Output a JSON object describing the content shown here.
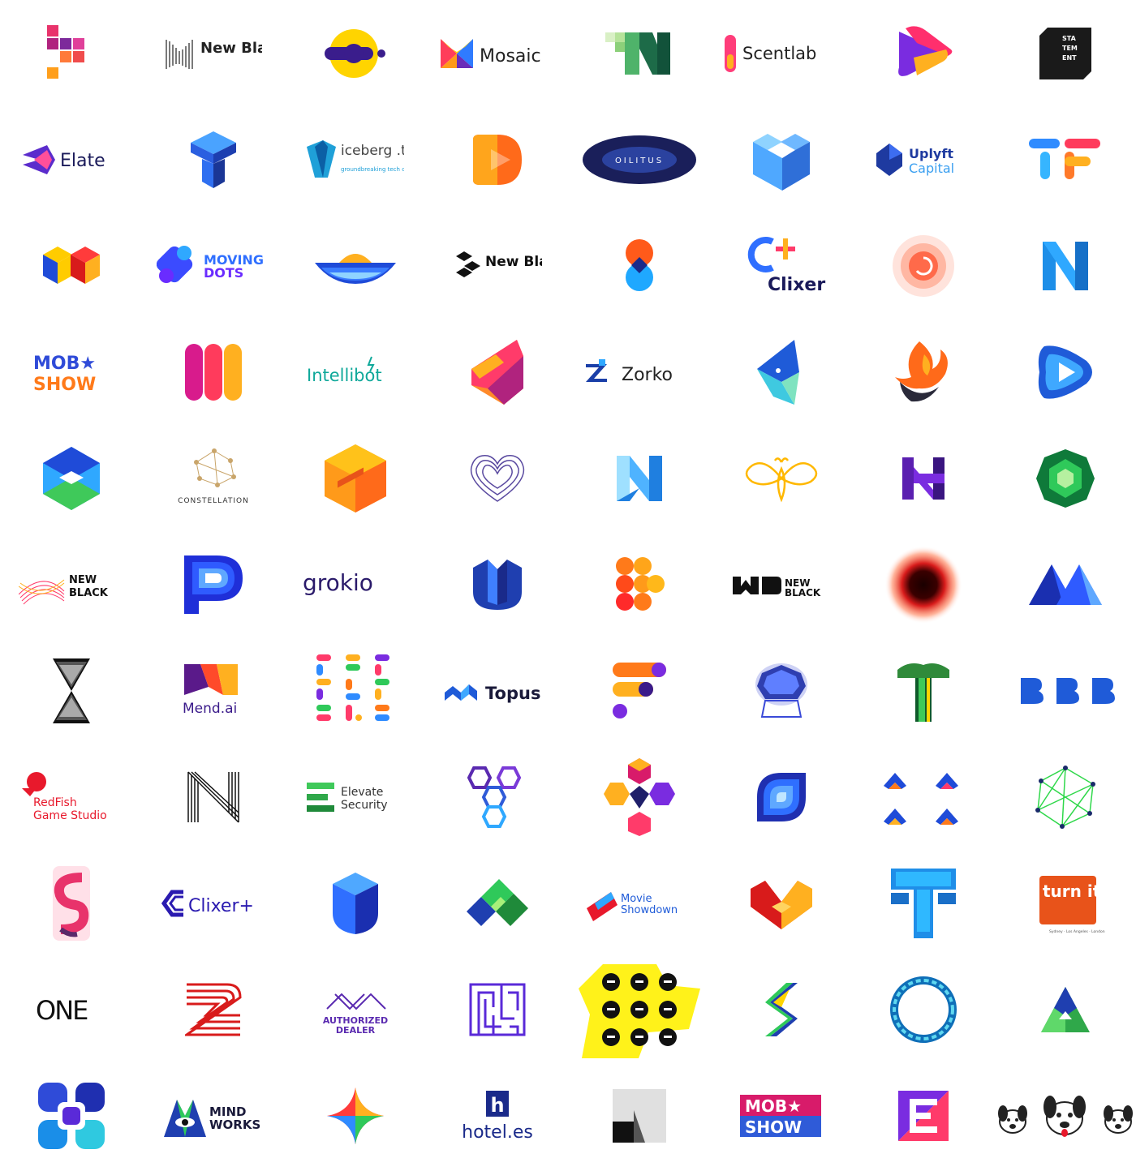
{
  "logos": [
    {
      "id": "pixel-n-mark",
      "text": ""
    },
    {
      "id": "new-black-1",
      "text": "New Black"
    },
    {
      "id": "yellow-c-orbit",
      "text": ""
    },
    {
      "id": "mosaic",
      "text": "Mosaic"
    },
    {
      "id": "green-n-pixel",
      "text": ""
    },
    {
      "id": "scentlab",
      "text": "Scentlab"
    },
    {
      "id": "play-ribbon",
      "text": ""
    },
    {
      "id": "statement",
      "text": "STA TEM ENT"
    },
    {
      "id": "elate",
      "text": "Elate"
    },
    {
      "id": "blue-t-cube",
      "text": ""
    },
    {
      "id": "iceberg-tech",
      "text": "iceberg .tech",
      "sub": "groundbreaking tech companies"
    },
    {
      "id": "orange-play",
      "text": ""
    },
    {
      "id": "oilitus",
      "text": "OILITUS"
    },
    {
      "id": "blue-cube-heart",
      "text": ""
    },
    {
      "id": "uplyft-capital",
      "text": "Uplyft",
      "sub": "Capital"
    },
    {
      "id": "tf-ribbons",
      "text": ""
    },
    {
      "id": "lego-heart",
      "text": ""
    },
    {
      "id": "moving-dots",
      "text": "MOVING",
      "sub": "DOTS"
    },
    {
      "id": "sunrise-waves",
      "text": ""
    },
    {
      "id": "new-black-2",
      "text": "New Black"
    },
    {
      "id": "figure-eight",
      "text": ""
    },
    {
      "id": "clixer-plus-1",
      "text": "Clixer+"
    },
    {
      "id": "spiral-sun",
      "text": ""
    },
    {
      "id": "blue-n-fold",
      "text": ""
    },
    {
      "id": "mob-show-1",
      "text": "MOB★",
      "sub": "SHOW"
    },
    {
      "id": "gradient-m",
      "text": ""
    },
    {
      "id": "intellibot",
      "text": "Intellibot"
    },
    {
      "id": "gradient-prism",
      "text": ""
    },
    {
      "id": "zorko",
      "text": "Zorko"
    },
    {
      "id": "blue-bird",
      "text": ""
    },
    {
      "id": "fire-phoenix",
      "text": ""
    },
    {
      "id": "blob-play",
      "text": ""
    },
    {
      "id": "hex-cube",
      "text": ""
    },
    {
      "id": "constellation",
      "text": "CONSTELLATION"
    },
    {
      "id": "orange-s-cube",
      "text": ""
    },
    {
      "id": "line-heart",
      "text": ""
    },
    {
      "id": "light-blue-n",
      "text": ""
    },
    {
      "id": "yellow-bee",
      "text": ""
    },
    {
      "id": "purple-n",
      "text": ""
    },
    {
      "id": "green-gem",
      "text": ""
    },
    {
      "id": "new-black-3",
      "text": "NEW",
      "sub": "BLACK"
    },
    {
      "id": "blue-p",
      "text": ""
    },
    {
      "id": "grokio",
      "text": "grokio"
    },
    {
      "id": "blue-tulip",
      "text": ""
    },
    {
      "id": "orange-dots",
      "text": ""
    },
    {
      "id": "new-black-4",
      "text": "NEW",
      "sub": "BLACK"
    },
    {
      "id": "black-hole",
      "text": ""
    },
    {
      "id": "blue-mountains",
      "text": ""
    },
    {
      "id": "hourglass",
      "text": ""
    },
    {
      "id": "mend-ai",
      "text": "Mend.ai"
    },
    {
      "id": "dot-grid",
      "text": ""
    },
    {
      "id": "topus",
      "text": "Topus"
    },
    {
      "id": "f-pills",
      "text": ""
    },
    {
      "id": "gem-ring",
      "text": ""
    },
    {
      "id": "green-t",
      "text": ""
    },
    {
      "id": "three-b",
      "text": ""
    },
    {
      "id": "redfish",
      "text": "RedFish",
      "sub": "Game Studio"
    },
    {
      "id": "line-n",
      "text": ""
    },
    {
      "id": "elevate-security",
      "text": "Elevate",
      "sub": "Security"
    },
    {
      "id": "hex-trio",
      "text": ""
    },
    {
      "id": "cube-flower",
      "text": ""
    },
    {
      "id": "blue-leaf",
      "text": ""
    },
    {
      "id": "crown-set",
      "text": ""
    },
    {
      "id": "green-network",
      "text": ""
    },
    {
      "id": "pink-s",
      "text": ""
    },
    {
      "id": "clixer-plus-2",
      "text": "Clixer+"
    },
    {
      "id": "blue-shield",
      "text": ""
    },
    {
      "id": "green-check",
      "text": ""
    },
    {
      "id": "movie-showdown",
      "text": "Movie",
      "sub": "Showdown"
    },
    {
      "id": "orange-m",
      "text": ""
    },
    {
      "id": "blue-t-pixel",
      "text": ""
    },
    {
      "id": "turn-it-up",
      "text": "turn it up",
      "sub": "Sydney · Los Angeles · London"
    },
    {
      "id": "one",
      "text": "ONE"
    },
    {
      "id": "red-z-lines",
      "text": ""
    },
    {
      "id": "authorized-dealer",
      "text": "AUTHORIZED",
      "sub": "DEALER"
    },
    {
      "id": "maze",
      "text": ""
    },
    {
      "id": "gorillas",
      "text": ""
    },
    {
      "id": "ribbon-s",
      "text": ""
    },
    {
      "id": "blue-ring",
      "text": ""
    },
    {
      "id": "green-a",
      "text": ""
    },
    {
      "id": "blue-knot",
      "text": ""
    },
    {
      "id": "mind-works",
      "text": "MIND",
      "sub": "WORKS"
    },
    {
      "id": "star-ribbon",
      "text": ""
    },
    {
      "id": "hotel-es",
      "text": "hotel.es",
      "sub": "h"
    },
    {
      "id": "grey-a",
      "text": ""
    },
    {
      "id": "mob-show-2",
      "text": "MOB★",
      "sub": "SHOW"
    },
    {
      "id": "stripe-e",
      "text": ""
    },
    {
      "id": "dogs",
      "text": ""
    }
  ]
}
